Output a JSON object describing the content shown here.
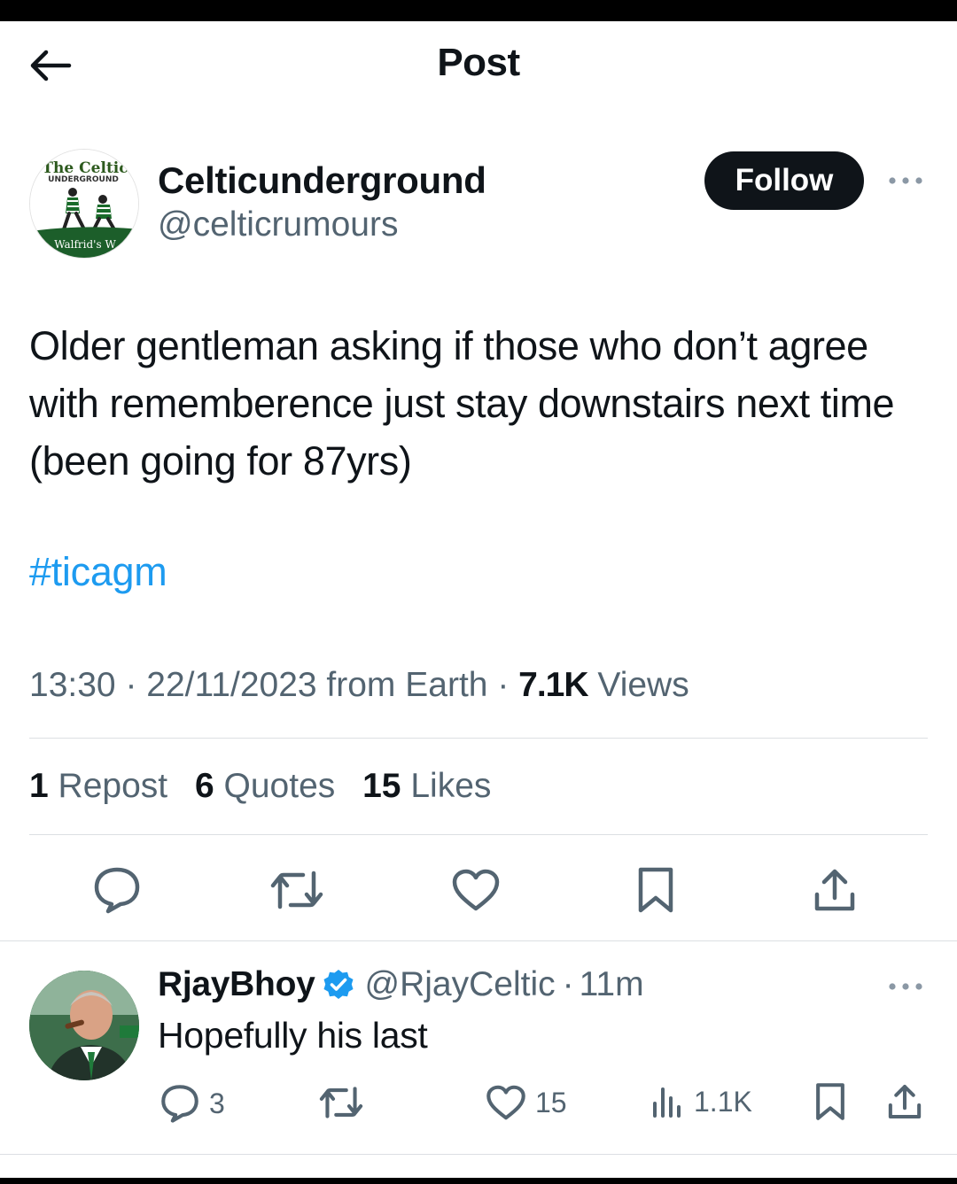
{
  "header": {
    "title": "Post"
  },
  "post": {
    "author": {
      "display_name": "Celticunderground",
      "handle": "@celticrumours",
      "avatar_text_top": "The Celtic",
      "avatar_text_sub": "UNDERGROUND",
      "avatar_text_bottom": "Walfrid's W"
    },
    "follow_label": "Follow",
    "text": "Older gentleman asking if those who don’t agree with rememberence just stay downstairs next time (been going for 87yrs)",
    "hashtag": "#ticagm",
    "meta": {
      "time": "13:30",
      "date": "22/11/2023",
      "source": "from Earth",
      "views_count": "7.1K",
      "views_label": "Views"
    },
    "stats": {
      "reposts_count": "1",
      "reposts_label": "Repost",
      "quotes_count": "6",
      "quotes_label": "Quotes",
      "likes_count": "15",
      "likes_label": "Likes"
    }
  },
  "reply": {
    "display_name": "RjayBhoy",
    "handle": "@RjayCeltic",
    "separator": "·",
    "time": "11m",
    "text": "Hopefully his last",
    "replies": "3",
    "likes": "15",
    "views": "1.1K"
  },
  "colors": {
    "text": "#0f1419",
    "muted": "#536471",
    "link": "#1d9bf0",
    "verified": "#1d9bf0",
    "follow_bg": "#0f1419",
    "divider": "#dcdfe3"
  },
  "icons": [
    "back-arrow-icon",
    "more-icon",
    "reply-icon",
    "repost-icon",
    "like-icon",
    "bookmark-icon",
    "share-icon",
    "verified-icon",
    "views-icon"
  ]
}
